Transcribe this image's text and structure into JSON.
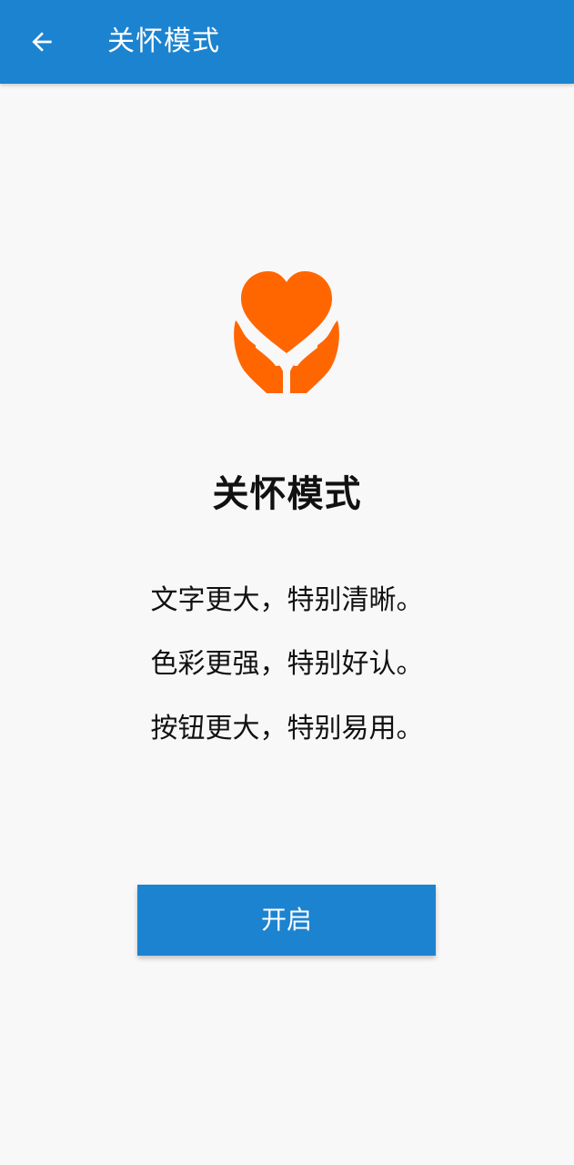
{
  "appbar": {
    "title": "关怀模式",
    "back_icon": "arrow-left-icon"
  },
  "hero": {
    "icon": "heart-in-hands-icon",
    "icon_color": "#ff6600"
  },
  "main": {
    "title": "关怀模式",
    "features": [
      "文字更大，特别清晰。",
      "色彩更强，特别好认。",
      "按钮更大，特别易用。"
    ],
    "enable_button_label": "开启"
  },
  "colors": {
    "primary": "#1c83d0",
    "background": "#f8f8f8",
    "accent": "#ff6600"
  }
}
